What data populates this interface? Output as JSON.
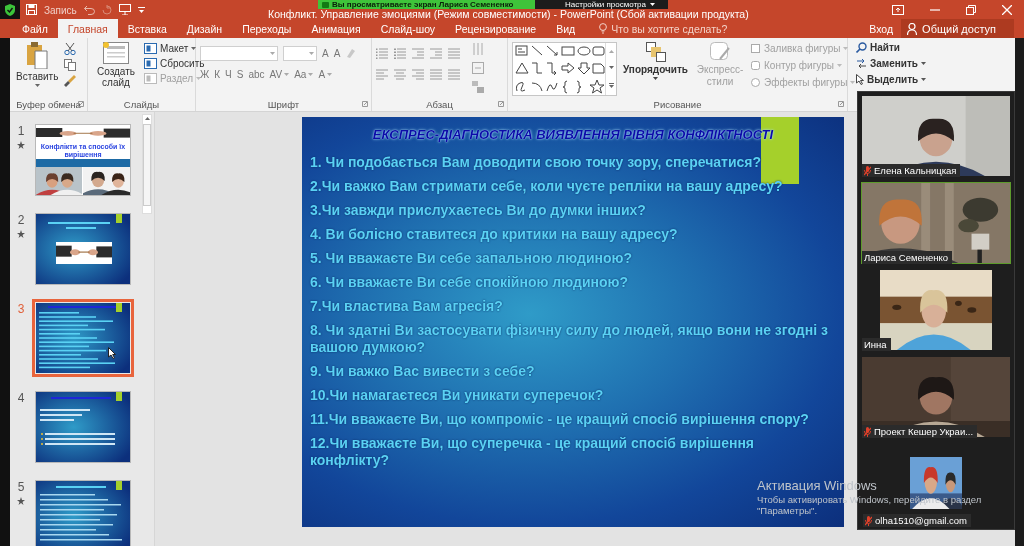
{
  "title_bar": {
    "recording": "Запись",
    "title": "Конфликт. Управление эмоциями (Режим совместимости) - PowerPoint (Сбой активации продукта)"
  },
  "share_banner": {
    "message": "Вы просматриваете экран Лариса Семененко",
    "options": "Настройки просмотра"
  },
  "tabs": [
    {
      "label": "Файл",
      "selected": false
    },
    {
      "label": "Главная",
      "selected": true
    },
    {
      "label": "Вставка",
      "selected": false
    },
    {
      "label": "Дизайн",
      "selected": false
    },
    {
      "label": "Переходы",
      "selected": false
    },
    {
      "label": "Анимация",
      "selected": false
    },
    {
      "label": "Слайд-шоу",
      "selected": false
    },
    {
      "label": "Рецензирование",
      "selected": false
    },
    {
      "label": "Вид",
      "selected": false
    }
  ],
  "tell_me": {
    "placeholder": "Что вы хотите сделать?"
  },
  "sign_in": "Вход",
  "share_button": "Общий доступ",
  "ribbon": {
    "clipboard": {
      "label": "Буфер обмена",
      "paste": "Вставить"
    },
    "slides": {
      "label": "Слайды",
      "new_slide": "Создать слайд",
      "items": [
        {
          "label": "Макет",
          "kind": "menu",
          "disabled": false
        },
        {
          "label": "Сбросить",
          "kind": "button",
          "disabled": false
        },
        {
          "label": "Раздел",
          "kind": "menu",
          "disabled": true
        }
      ]
    },
    "font": {
      "label": "Шрифт",
      "size_buttons": [
        "A",
        "A"
      ],
      "format_buttons": [
        {
          "label": "Ж",
          "kind": "button"
        },
        {
          "label": "К",
          "kind": "button"
        },
        {
          "label": "Ч",
          "kind": "button"
        },
        {
          "label": "S",
          "kind": "button"
        },
        {
          "label": "abc",
          "kind": "button"
        },
        {
          "label": "AV",
          "kind": "menu"
        },
        {
          "label": "Aa",
          "kind": "menu"
        },
        {
          "label": "A",
          "kind": "menu"
        }
      ]
    },
    "paragraph": {
      "label": "Абзац"
    },
    "drawing": {
      "label": "Рисование",
      "arrange": "Упорядочить",
      "quick_styles": {
        "label": "Экспресс-стили",
        "disabled": true
      },
      "shape_format": [
        {
          "label": "Заливка фигуры",
          "disabled": true
        },
        {
          "label": "Контур фигуры",
          "disabled": true
        },
        {
          "label": "Эффекты фигуры",
          "disabled": true
        }
      ]
    },
    "editing": [
      {
        "label": "Найти",
        "kind": "find"
      },
      {
        "label": "Заменить",
        "kind": "replace"
      },
      {
        "label": "Выделить",
        "kind": "select"
      }
    ]
  },
  "slide_panel": [
    {
      "number": "1",
      "starred": true,
      "selected": false,
      "kind": "title",
      "title": "Конфлікти та способи їх вирішення"
    },
    {
      "number": "2",
      "starred": true,
      "selected": false,
      "kind": "picture"
    },
    {
      "number": "3",
      "starred": false,
      "selected": true,
      "kind": "list"
    },
    {
      "number": "4",
      "starred": false,
      "selected": false,
      "kind": "bullets"
    },
    {
      "number": "5",
      "starred": true,
      "selected": false,
      "kind": "text"
    }
  ],
  "slide": {
    "title": "ЕКСПРЕС-ДІАГНОСТИКА ВИЯВЛЕННЯ РІВНЯ КОНФЛІКТНОСТІ",
    "questions": [
      "1. Чи подобається Вам доводити свою точку зору, сперечатися?",
      "2.Чи важко Вам стримати себе, коли чуєте репліки на вашу адресу?",
      "3.Чи завжди прислухаєтесь Ви до думки інших?",
      "4. Ви болісно ставитеся до критики на вашу адресу?",
      "5. Чи вважаєте Ви себе запальною людиною?",
      "6. Чи вважаєте Ви себе спокійною людиною?",
      "7.Чи властива Вам агресія?",
      "8. Чи здатні Ви застосувати фізичну силу до людей, якщо вони не згодні з вашою думкою?",
      "9. Чи важко Вас вивести з себе?",
      "10.Чи намагаєтеся Ви уникати суперечок?",
      "11.Чи вважаєте Ви, що компроміс - це кращий спосіб вирішення спору?",
      "12.Чи вважаєте Ви, що суперечка - це кращий спосіб вирішення конфлікту?"
    ]
  },
  "activation_notice": {
    "heading": "Активация Windows",
    "body": "Чтобы активировать Windows, перейдите в раздел \"Параметры\"."
  },
  "participants": [
    {
      "name": "Елена Кальницкая",
      "muted": true,
      "speaking": false,
      "kind": "video"
    },
    {
      "name": "Лариса Семененко",
      "muted": false,
      "speaking": true,
      "kind": "video"
    },
    {
      "name": "Инна",
      "muted": false,
      "speaking": false,
      "kind": "video"
    },
    {
      "name": "Проект Кешер Украи...",
      "muted": true,
      "speaking": false,
      "kind": "video"
    },
    {
      "name": "olha1510@gmail.com",
      "muted": true,
      "speaking": false,
      "kind": "avatar"
    }
  ]
}
